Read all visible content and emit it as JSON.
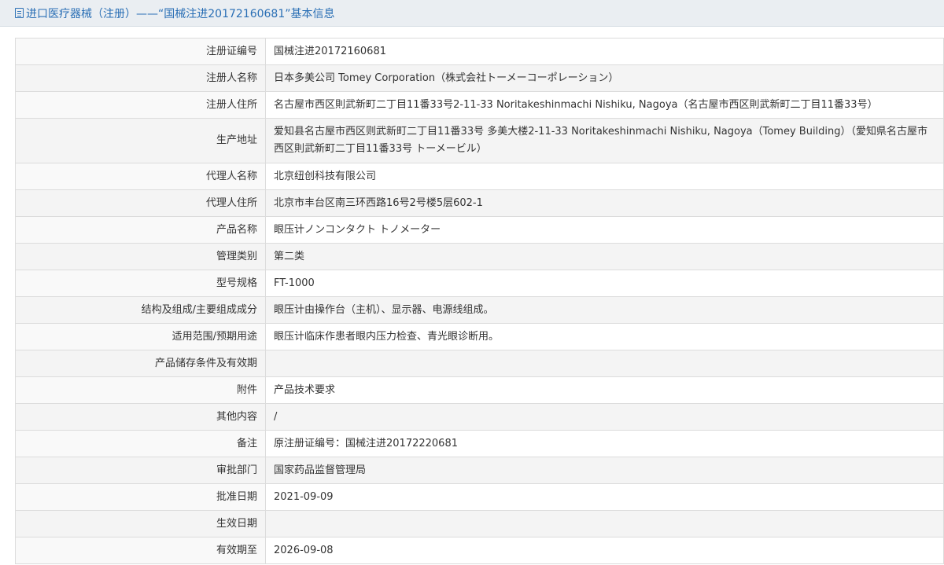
{
  "header": {
    "title": "进口医疗器械（注册）——“国械注进20172160681”基本信息"
  },
  "rows": [
    {
      "label": "注册证编号",
      "value": "国械注进20172160681"
    },
    {
      "label": "注册人名称",
      "value": "日本多美公司 Tomey Corporation（株式会社トーメーコーポレーション）"
    },
    {
      "label": "注册人住所",
      "value": "名古屋市西区則武新町二丁目11番33号2-11-33 Noritakeshinmachi Nishiku, Nagoya（名古屋市西区則武新町二丁目11番33号）"
    },
    {
      "label": "生产地址",
      "value": "爱知县名古屋市西区则武新町二丁目11番33号 多美大楼2-11-33 Noritakeshinmachi Nishiku, Nagoya（Tomey Building）（愛知県名古屋市西区則武新町二丁目11番33号 トーメービル）"
    },
    {
      "label": "代理人名称",
      "value": "北京纽创科技有限公司"
    },
    {
      "label": "代理人住所",
      "value": "北京市丰台区南三环西路16号2号楼5层602-1"
    },
    {
      "label": "产品名称",
      "value": "眼压计ノンコンタクト トノメーター"
    },
    {
      "label": "管理类别",
      "value": "第二类"
    },
    {
      "label": "型号规格",
      "value": "FT-1000"
    },
    {
      "label": "结构及组成/主要组成成分",
      "value": "眼压计由操作台（主机）、显示器、电源线组成。"
    },
    {
      "label": "适用范围/预期用途",
      "value": "眼压计临床作患者眼内压力检查、青光眼诊断用。"
    },
    {
      "label": "产品储存条件及有效期",
      "value": ""
    },
    {
      "label": "附件",
      "value": "产品技术要求"
    },
    {
      "label": "其他内容",
      "value": "/"
    },
    {
      "label": "备注",
      "value": "原注册证编号：国械注进20172220681"
    },
    {
      "label": "审批部门",
      "value": "国家药品监督管理局"
    },
    {
      "label": "批准日期",
      "value": "2021-09-09"
    },
    {
      "label": "生效日期",
      "value": ""
    },
    {
      "label": "有效期至",
      "value": "2026-09-08"
    }
  ]
}
